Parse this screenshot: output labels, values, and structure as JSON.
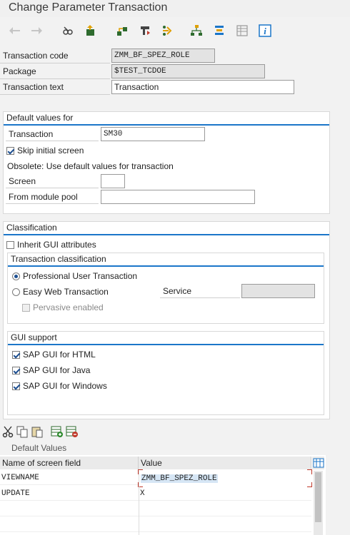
{
  "window": {
    "title": "Change Parameter Transaction"
  },
  "toolbar": {
    "buttons": [
      {
        "icon": "back-arrow-icon"
      },
      {
        "icon": "forward-arrow-icon"
      },
      {
        "icon": "display-change-icon"
      },
      {
        "icon": "other-object-icon"
      },
      {
        "icon": "object-list-icon"
      },
      {
        "icon": "where-used-icon"
      },
      {
        "icon": "navigate-icon"
      },
      {
        "icon": "hierarchy-icon"
      },
      {
        "icon": "stack-icon"
      },
      {
        "icon": "table-icon"
      },
      {
        "icon": "info-icon"
      }
    ]
  },
  "header_fields": {
    "transaction_code_label": "Transaction code",
    "transaction_code_value": "ZMM_BF_SPEZ_ROLE",
    "package_label": "Package",
    "package_value": "$TEST_TCDOE",
    "transaction_text_label": "Transaction text",
    "transaction_text_value": "Transaction"
  },
  "default_values": {
    "title": "Default values for",
    "transaction_label": "Transaction",
    "transaction_value": "SM30",
    "skip_initial_screen_label": "Skip initial screen",
    "skip_initial_screen_checked": true,
    "obsolete_text": "Obsolete: Use default values for transaction",
    "screen_label": "Screen",
    "screen_value": "",
    "module_pool_label": "From module pool",
    "module_pool_value": ""
  },
  "classification": {
    "title": "Classification",
    "inherit_gui_label": "Inherit GUI attributes",
    "inherit_gui_checked": false,
    "transaction_classification_title": "Transaction classification",
    "professional_label": "Professional User Transaction",
    "professional_selected": true,
    "easy_web_label": "Easy Web Transaction",
    "easy_web_selected": false,
    "service_label": "Service",
    "service_value": "",
    "pervasive_label": "Pervasive enabled",
    "pervasive_checked": false,
    "gui_support_title": "GUI support",
    "gui_html_label": "SAP GUI for HTML",
    "gui_java_label": "SAP GUI for Java",
    "gui_windows_label": "SAP GUI for Windows"
  },
  "table": {
    "title": "Default Values",
    "columns": [
      "Name of screen field",
      "Value"
    ],
    "rows": [
      {
        "field": "VIEWNAME",
        "value": "ZMM_BF_SPEZ_ROLE"
      },
      {
        "field": "UPDATE",
        "value": "X"
      }
    ]
  },
  "colors": {
    "accent": "#1b76c9",
    "background": "#f2f2f2"
  }
}
